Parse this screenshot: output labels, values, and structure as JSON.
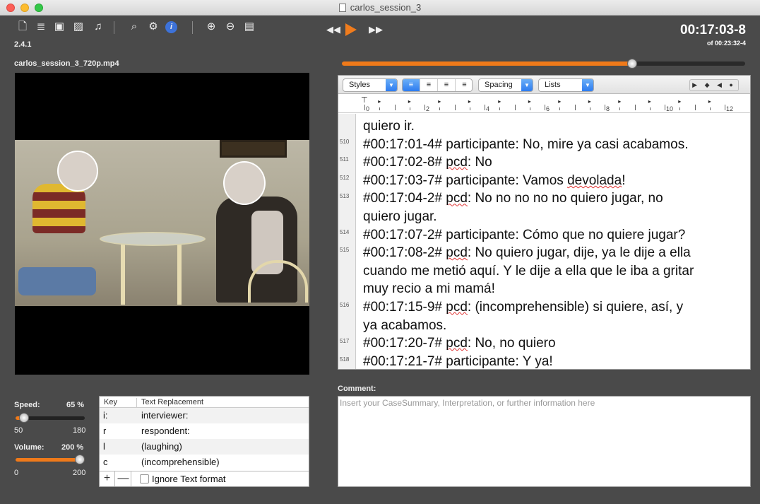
{
  "window": {
    "title": "carlos_session_3",
    "version": "2.4.1",
    "filename": "carlos_session_3_720p.mp4"
  },
  "toolbar": {
    "icons": [
      "new-document-icon",
      "transcript-icon",
      "save-icon",
      "export-icon",
      "music-icon",
      "search-icon",
      "settings-icon",
      "info-icon",
      "zoom-in-icon",
      "zoom-out-icon",
      "clapperboard-icon"
    ]
  },
  "timecode": {
    "current": "00:17:03-8",
    "total": "of 00:23:32-4",
    "progress": 0.72
  },
  "controls": {
    "speed_label": "Speed:",
    "speed_value": "65 %",
    "speed_min": "50",
    "speed_max": "180",
    "speed_fraction": 0.12,
    "volume_label": "Volume:",
    "volume_value": "200 %",
    "volume_min": "0",
    "volume_max": "200",
    "volume_fraction": 1.0
  },
  "keytable": {
    "headers": {
      "key": "Key",
      "replacement": "Text Replacement"
    },
    "rows": [
      {
        "key": "i:",
        "value": "interviewer:"
      },
      {
        "key": "r",
        "value": "respondent:"
      },
      {
        "key": "l",
        "value": "(laughing)"
      },
      {
        "key": "c",
        "value": "(incomprehensible)"
      }
    ],
    "add": "+",
    "remove": "—",
    "ignore_label": "Ignore Text format"
  },
  "format": {
    "styles": "Styles",
    "spacing": "Spacing",
    "lists": "Lists",
    "nav": "▶ ◆ ◀ ●"
  },
  "ruler": {
    "numbers": [
      "0",
      "2",
      "4",
      "6",
      "8",
      "10",
      "12"
    ]
  },
  "transcript": {
    "line_numbers": [
      "510",
      "511",
      "512",
      "513",
      "514",
      "515",
      "516",
      "517",
      "518"
    ],
    "lines": [
      "quiero ir.",
      " #00:17:01-4# participante: No, mire ya casi acabamos.",
      " #00:17:02-8# pcd: No",
      " #00:17:03-7# participante: Vamos devolada!",
      " #00:17:04-2# pcd: No no no no no quiero jugar, no",
      "quiero jugar.",
      " #00:17:07-2# participante: Cómo que no quiere jugar?",
      " #00:17:08-2# pcd: No quiero jugar, dije, ya le dije a ella",
      "cuando me metió aquí. Y le dije a ella que le iba a gritar",
      "muy recio a mi mamá!",
      " #00:17:15-9# pcd: (incomprehensible) si quiere, así, y",
      "ya acabamos.",
      " #00:17:20-7# pcd: No, no quiero",
      " #00:17:21-7# participante: Y ya!"
    ]
  },
  "comment": {
    "label": "Comment:",
    "placeholder": "Insert your CaseSummary, Interpretation, or further information here"
  }
}
